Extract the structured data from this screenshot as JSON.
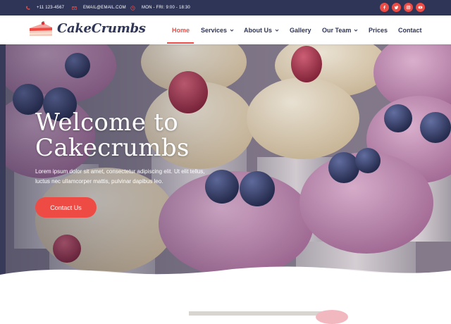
{
  "topbar": {
    "phone": "+11 123-4567",
    "email": "EMAIL@EMAIL.COM",
    "hours": "MON - FRI: 9:00 - 18:30",
    "social": [
      "facebook-icon",
      "twitter-icon",
      "instagram-icon",
      "youtube-icon"
    ]
  },
  "header": {
    "brand": "CakeCrumbs",
    "nav": {
      "home": "Home",
      "services": "Services",
      "about": "About Us",
      "gallery": "Gallery",
      "team": "Our Team",
      "prices": "Prices",
      "contact": "Contact"
    },
    "active_item": "Home"
  },
  "hero": {
    "title": "Welcome to Cakecrumbs",
    "text": "Lorem ipsum dolor sit amet, consectetur adipiscing elit. Ut elit tellus, luctus nec ullamcorper mattis, pulvinar dapibus leo.",
    "cta": "Contact Us"
  },
  "colors": {
    "accent": "#ef4b45",
    "navy": "#2f3557",
    "frosting_pink": "#c98fb8",
    "frosting_cream": "#f1e3c4",
    "blueberry": "#3e4a78",
    "raspberry": "#b5384f"
  }
}
